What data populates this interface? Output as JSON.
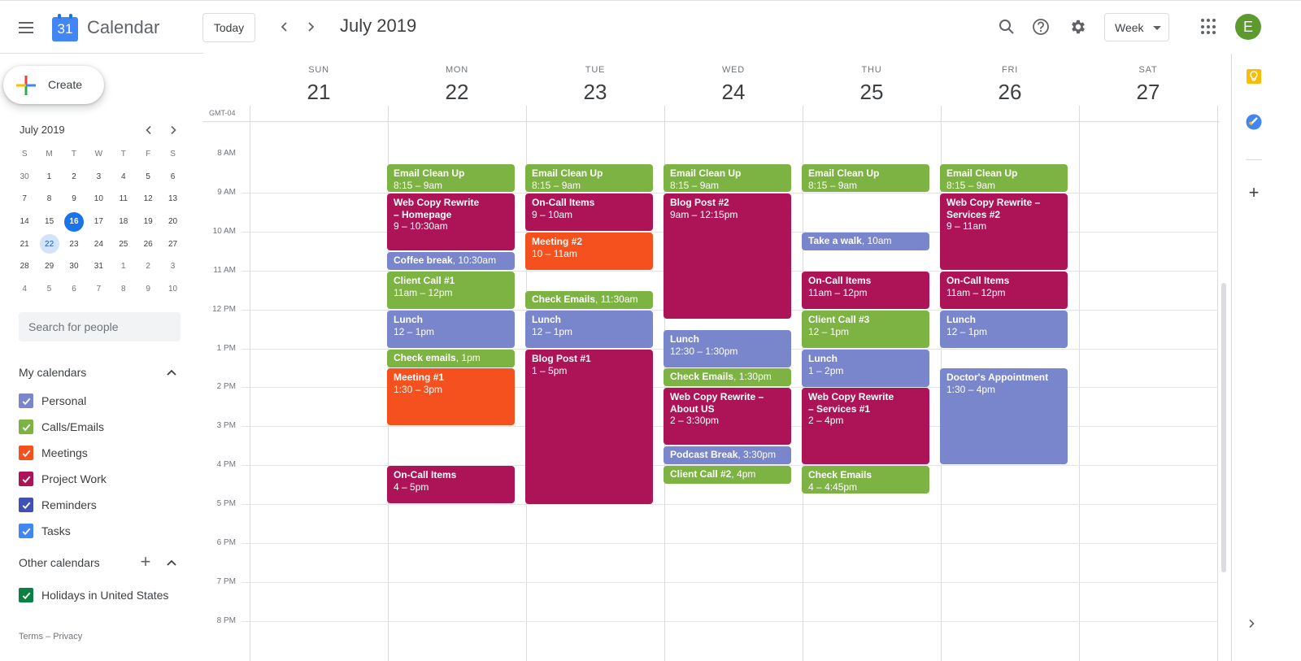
{
  "app": {
    "title": "Calendar",
    "logo_day": "31"
  },
  "header": {
    "today_label": "Today",
    "prev_icon": "chevron-left-icon",
    "next_icon": "chevron-right-icon",
    "period_title": "July 2019",
    "view_select": "Week",
    "avatar_initial": "E",
    "avatar_color": "#5d9a2e"
  },
  "sidebar": {
    "create_label": "Create",
    "mini_calendar": {
      "title": "July 2019",
      "weekdays": [
        "S",
        "M",
        "T",
        "W",
        "T",
        "F",
        "S"
      ],
      "weeks": [
        [
          "30",
          "1",
          "2",
          "3",
          "4",
          "5",
          "6"
        ],
        [
          "7",
          "8",
          "9",
          "10",
          "11",
          "12",
          "13"
        ],
        [
          "14",
          "15",
          "16",
          "17",
          "18",
          "19",
          "20"
        ],
        [
          "21",
          "22",
          "23",
          "24",
          "25",
          "26",
          "27"
        ],
        [
          "28",
          "29",
          "30",
          "31",
          "1",
          "2",
          "3"
        ],
        [
          "4",
          "5",
          "6",
          "7",
          "8",
          "9",
          "10"
        ]
      ],
      "today": "16",
      "selected": "22"
    },
    "search_placeholder": "Search for people",
    "my_calendars_label": "My calendars",
    "my_calendars": [
      {
        "label": "Personal",
        "color": "#7986cb"
      },
      {
        "label": "Calls/Emails",
        "color": "#7cb342"
      },
      {
        "label": "Meetings",
        "color": "#f4511e"
      },
      {
        "label": "Project Work",
        "color": "#ad1457"
      },
      {
        "label": "Reminders",
        "color": "#3f51b5"
      },
      {
        "label": "Tasks",
        "color": "#4285f4"
      }
    ],
    "other_calendars_label": "Other calendars",
    "other_calendars": [
      {
        "label": "Holidays in United States",
        "color": "#0b8043"
      }
    ],
    "footer": {
      "terms": "Terms",
      "separator": "–",
      "privacy": "Privacy"
    }
  },
  "grid": {
    "timezone": "GMT-04",
    "days": [
      {
        "dow": "SUN",
        "num": "21"
      },
      {
        "dow": "MON",
        "num": "22"
      },
      {
        "dow": "TUE",
        "num": "23"
      },
      {
        "dow": "WED",
        "num": "24"
      },
      {
        "dow": "THU",
        "num": "25"
      },
      {
        "dow": "FRI",
        "num": "26"
      },
      {
        "dow": "SAT",
        "num": "27"
      }
    ],
    "hours": [
      "8 AM",
      "9 AM",
      "10 AM",
      "11 AM",
      "12 PM",
      "1 PM",
      "2 PM",
      "3 PM",
      "4 PM",
      "5 PM",
      "6 PM",
      "7 PM",
      "8 PM"
    ],
    "first_hour": 8
  },
  "colors": {
    "personal": "#7986cb",
    "calls": "#7cb342",
    "meetings": "#f4511e",
    "project": "#ad1457"
  },
  "events": [
    {
      "day": 1,
      "title": "Email Clean Up",
      "time": "8:15 – 9am",
      "start": 8.25,
      "end": 9,
      "cal": "calls"
    },
    {
      "day": 1,
      "title": "Web Copy Rewrite – Homepage",
      "time": "9 – 10:30am",
      "start": 9,
      "end": 10.5,
      "cal": "project",
      "wrap": true
    },
    {
      "day": 1,
      "title": "Coffee break",
      "time": "10:30am",
      "start": 10.5,
      "end": 11,
      "cal": "personal",
      "inline": true
    },
    {
      "day": 1,
      "title": "Client Call #1",
      "time": "11am – 12pm",
      "start": 11,
      "end": 12,
      "cal": "calls"
    },
    {
      "day": 1,
      "title": "Lunch",
      "time": "12 – 1pm",
      "start": 12,
      "end": 13,
      "cal": "personal"
    },
    {
      "day": 1,
      "title": "Check emails",
      "time": "1pm",
      "start": 13,
      "end": 13.5,
      "cal": "calls",
      "inline": true
    },
    {
      "day": 1,
      "title": "Meeting #1",
      "time": "1:30 – 3pm",
      "start": 13.5,
      "end": 15,
      "cal": "meetings"
    },
    {
      "day": 1,
      "title": "On-Call Items",
      "time": "4 – 5pm",
      "start": 16,
      "end": 17,
      "cal": "project"
    },
    {
      "day": 2,
      "title": "Email Clean Up",
      "time": "8:15 – 9am",
      "start": 8.25,
      "end": 9,
      "cal": "calls"
    },
    {
      "day": 2,
      "title": "On-Call Items",
      "time": "9 – 10am",
      "start": 9,
      "end": 10,
      "cal": "project"
    },
    {
      "day": 2,
      "title": "Meeting #2",
      "time": "10 – 11am",
      "start": 10,
      "end": 11,
      "cal": "meetings"
    },
    {
      "day": 2,
      "title": "Check Emails",
      "time": "11:30am",
      "start": 11.5,
      "end": 12,
      "cal": "calls",
      "inline": true
    },
    {
      "day": 2,
      "title": "Lunch",
      "time": "12 – 1pm",
      "start": 12,
      "end": 13,
      "cal": "personal"
    },
    {
      "day": 2,
      "title": "Blog Post #1",
      "time": "1 – 5pm",
      "start": 13,
      "end": 17,
      "cal": "project"
    },
    {
      "day": 3,
      "title": "Email Clean Up",
      "time": "8:15 – 9am",
      "start": 8.25,
      "end": 9,
      "cal": "calls"
    },
    {
      "day": 3,
      "title": "Blog Post #2",
      "time": "9am – 12:15pm",
      "start": 9,
      "end": 12.25,
      "cal": "project"
    },
    {
      "day": 3,
      "title": "Lunch",
      "time": "12:30 – 1:30pm",
      "start": 12.5,
      "end": 13.5,
      "cal": "personal"
    },
    {
      "day": 3,
      "title": "Check Emails",
      "time": "1:30pm",
      "start": 13.5,
      "end": 14,
      "cal": "calls",
      "inline": true
    },
    {
      "day": 3,
      "title": "Web Copy Rewrite – About US",
      "time": "2 – 3:30pm",
      "start": 14,
      "end": 15.5,
      "cal": "project"
    },
    {
      "day": 3,
      "title": "Podcast Break",
      "time": "3:30pm",
      "start": 15.5,
      "end": 16,
      "cal": "personal",
      "inline": true
    },
    {
      "day": 3,
      "title": "Client Call #2",
      "time": "4pm",
      "start": 16,
      "end": 16.5,
      "cal": "calls",
      "inline": true
    },
    {
      "day": 4,
      "title": "Email Clean Up",
      "time": "8:15 – 9am",
      "start": 8.25,
      "end": 9,
      "cal": "calls"
    },
    {
      "day": 4,
      "title": "Take a walk",
      "time": "10am",
      "start": 10,
      "end": 10.5,
      "cal": "personal",
      "inline": true
    },
    {
      "day": 4,
      "title": "On-Call Items",
      "time": "11am – 12pm",
      "start": 11,
      "end": 12,
      "cal": "project"
    },
    {
      "day": 4,
      "title": "Client Call #3",
      "time": "12 – 1pm",
      "start": 12,
      "end": 13,
      "cal": "calls"
    },
    {
      "day": 4,
      "title": "Lunch",
      "time": "1 – 2pm",
      "start": 13,
      "end": 14,
      "cal": "personal"
    },
    {
      "day": 4,
      "title": "Web Copy Rewrite – Services #1",
      "time": "2 – 4pm",
      "start": 14,
      "end": 16,
      "cal": "project",
      "wrap": true
    },
    {
      "day": 4,
      "title": "Check Emails",
      "time": "4 – 4:45pm",
      "start": 16,
      "end": 16.75,
      "cal": "calls"
    },
    {
      "day": 5,
      "title": "Email Clean Up",
      "time": "8:15 – 9am",
      "start": 8.25,
      "end": 9,
      "cal": "calls"
    },
    {
      "day": 5,
      "title": "Web Copy Rewrite – Services #2",
      "time": "9 – 11am",
      "start": 9,
      "end": 11,
      "cal": "project"
    },
    {
      "day": 5,
      "title": "On-Call Items",
      "time": "11am – 12pm",
      "start": 11,
      "end": 12,
      "cal": "project"
    },
    {
      "day": 5,
      "title": "Lunch",
      "time": "12 – 1pm",
      "start": 12,
      "end": 13,
      "cal": "personal"
    },
    {
      "day": 5,
      "title": "Doctor's Appointment",
      "time": "1:30 – 4pm",
      "start": 13.5,
      "end": 16,
      "cal": "personal"
    }
  ]
}
